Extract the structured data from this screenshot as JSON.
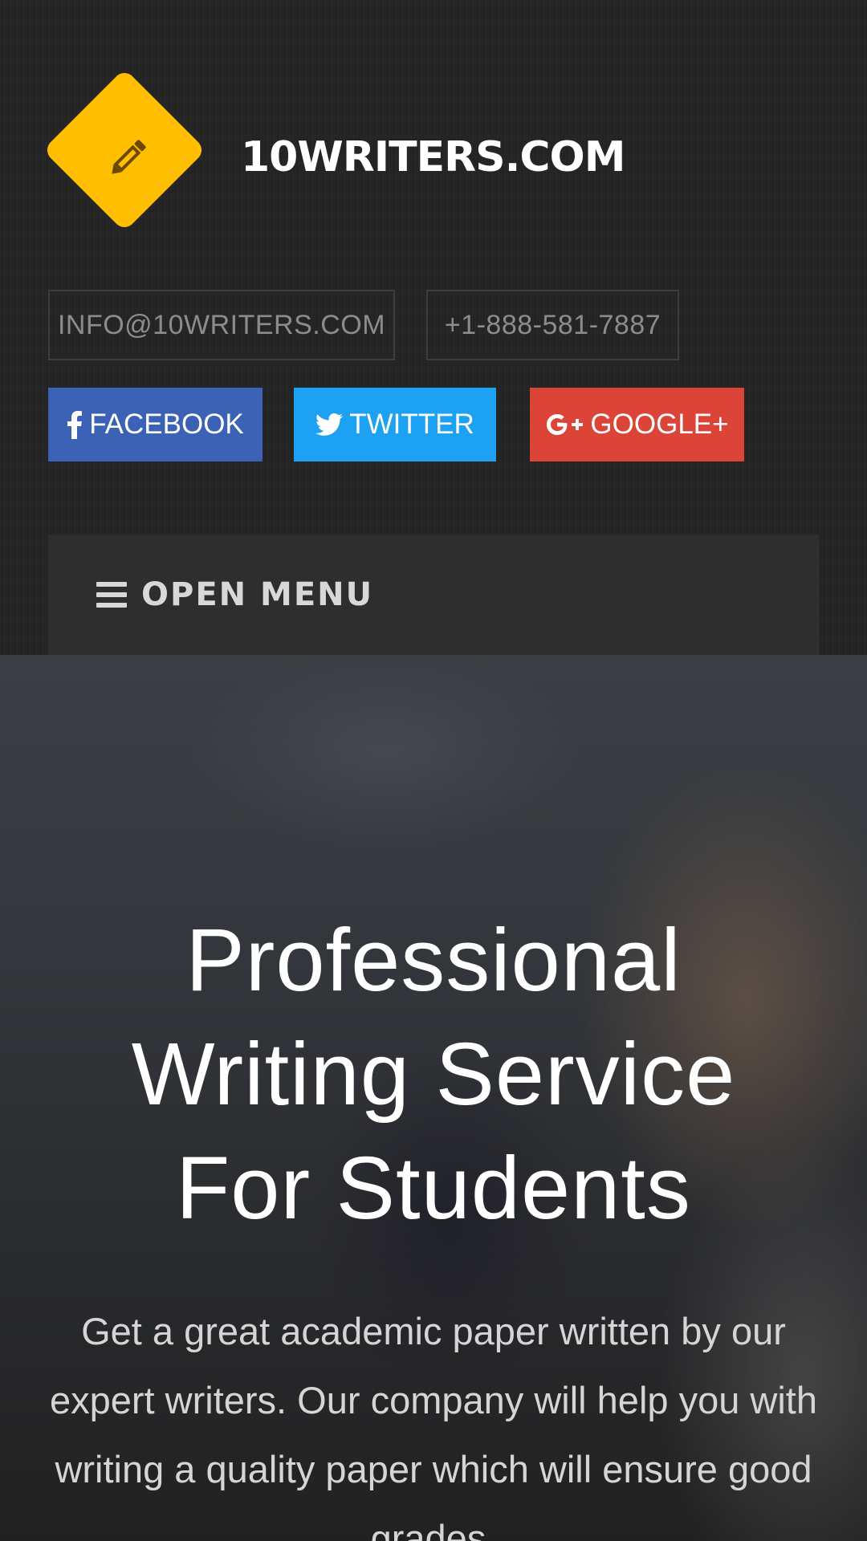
{
  "header": {
    "site_name": "10WRITERS.COM",
    "logo_icon": "pencil-icon",
    "logo_color": "#ffbe00"
  },
  "contact": {
    "email": "INFO@10WRITERS.COM",
    "phone": "+1-888-581-7887"
  },
  "social": {
    "facebook": {
      "label": "FACEBOOK",
      "icon": "facebook-icon",
      "color": "#3b62b4"
    },
    "twitter": {
      "label": "TWITTER",
      "icon": "twitter-icon",
      "color": "#1da1f2"
    },
    "google": {
      "label": "GOOGLE+",
      "icon": "google-plus-icon",
      "color": "#dc4437"
    }
  },
  "nav": {
    "menu_label": "OPEN MENU",
    "menu_icon": "hamburger-icon"
  },
  "hero": {
    "title_line1": "Professional",
    "title_line2": "Writing Service",
    "title_line3": "For Students",
    "text": "Get a great academic paper written by our expert writers. Our company will help you with writing a quality paper which will ensure good grades."
  }
}
